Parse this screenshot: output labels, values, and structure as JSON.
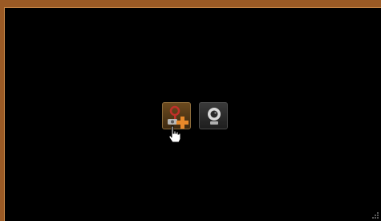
{
  "screen": {
    "background_color": "#000000",
    "frame_color": "#9a5a25"
  },
  "toolbar": {
    "items": [
      {
        "icon": "add-camera-icon",
        "state": "hovered"
      },
      {
        "icon": "webcam-icon",
        "state": "normal"
      }
    ]
  },
  "pointer": {
    "icon": "hand-pointer-icon"
  },
  "corner": {
    "icon": "resize-grip-icon"
  }
}
